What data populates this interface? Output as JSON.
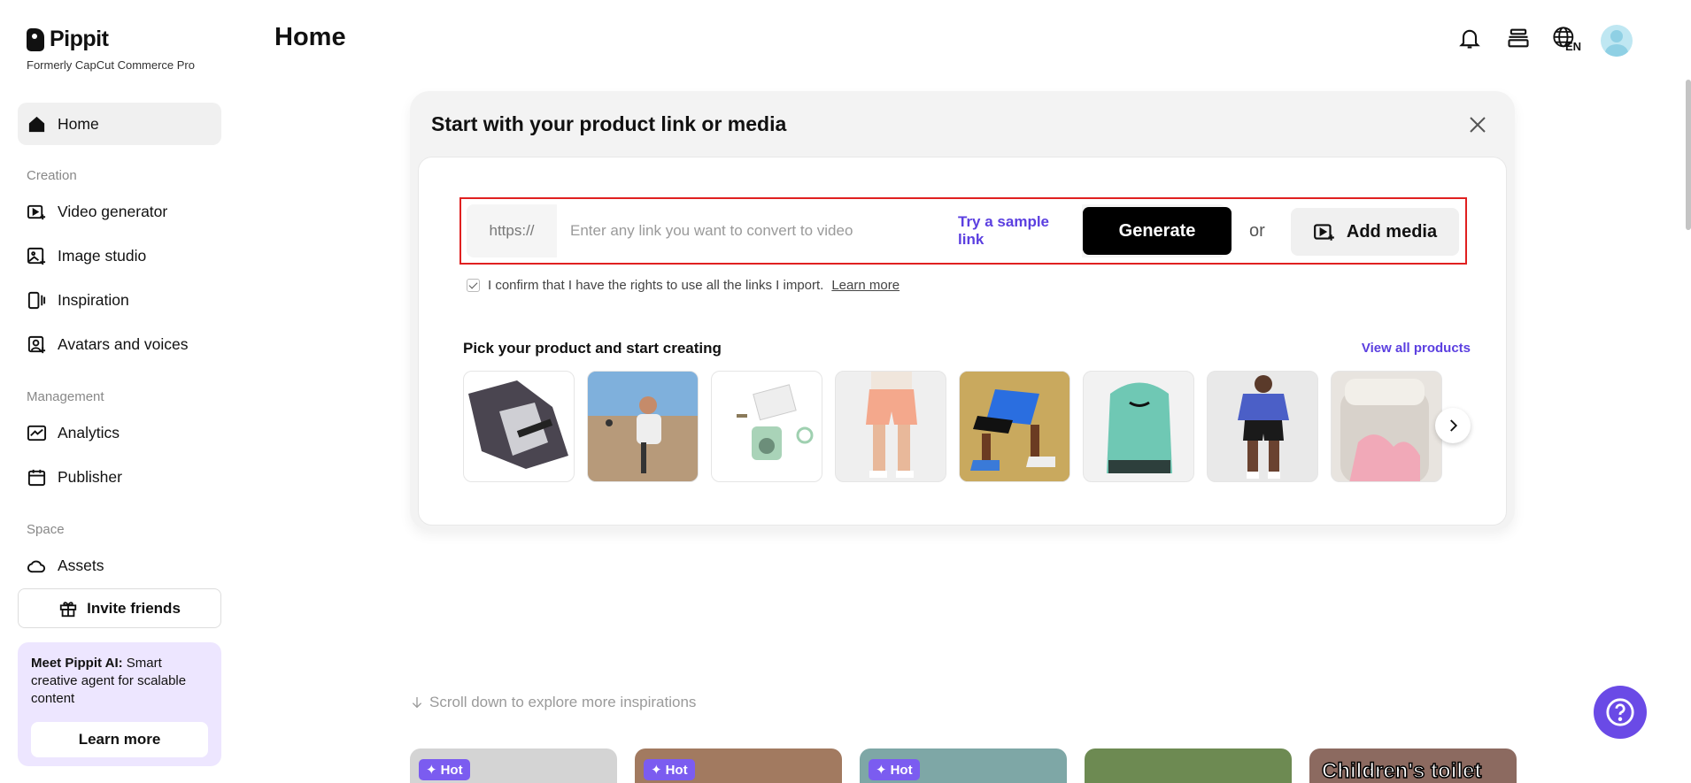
{
  "brand": {
    "name": "Pippit",
    "subtitle": "Formerly CapCut Commerce Pro"
  },
  "sidebar": {
    "home": "Home",
    "creation_label": "Creation",
    "creation_items": [
      "Video generator",
      "Image studio",
      "Inspiration",
      "Avatars and voices"
    ],
    "management_label": "Management",
    "management_items": [
      "Analytics",
      "Publisher"
    ],
    "space_label": "Space",
    "space_items": [
      "Assets"
    ],
    "invite_label": "Invite friends",
    "promo": {
      "bold": "Meet Pippit AI:",
      "text": " Smart creative agent for scalable content",
      "button": "Learn more"
    }
  },
  "header": {
    "title": "Home",
    "language": "EN",
    "icons": [
      "bell-icon",
      "layers-icon",
      "globe-icon",
      "avatar"
    ]
  },
  "card": {
    "title": "Start with your product link or media",
    "url_prefix": "https://",
    "url_placeholder": "Enter any link you want to convert to video",
    "sample_link": "Try a sample link",
    "generate": "Generate",
    "or": "or",
    "add_media": "Add media",
    "confirm_text": "I confirm that I have the rights to use all the links I import.",
    "learn_more": "Learn more",
    "pick_title": "Pick your product and start creating",
    "view_all": "View all products",
    "products": [
      "backpack-open",
      "beach-scooter",
      "instant-camera",
      "pink-shorts",
      "running-shoes",
      "teal-backpack",
      "athletic-shorts",
      "tumbler"
    ]
  },
  "bottom": {
    "scroll_hint": "Scroll down to explore more inspirations",
    "hot_label": "Hot",
    "caption": "Children's toilet"
  },
  "colors": {
    "accent": "#5b3fe0",
    "help_button": "#6a4ae6",
    "highlight_border": "#e02020"
  }
}
